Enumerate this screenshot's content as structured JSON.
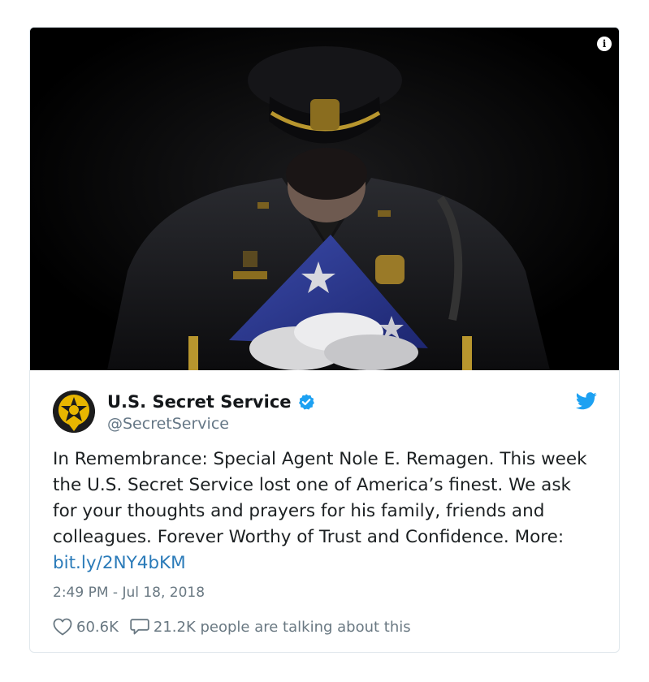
{
  "media": {
    "info_icon": "info-icon",
    "info_glyph": "i"
  },
  "author": {
    "display_name": "U.S. Secret Service",
    "handle": "@SecretService",
    "verified_icon": "verified-badge-icon",
    "avatar_icon": "secret-service-star-badge-icon"
  },
  "platform_icon": "twitter-bird-icon",
  "tweet": {
    "text": "In Remembrance: Special Agent Nole E. Remagen. This week the U.S. Secret Service lost one of America’s finest. We ask for your thoughts and prayers for his family, friends and colleagues. Forever Worthy of Trust and Confidence. More: ",
    "link": "bit.ly/2NY4bKM",
    "timestamp": "2:49 PM - Jul 18, 2018"
  },
  "actions": {
    "like_icon": "heart-icon",
    "like_count": "60.6K",
    "reply_icon": "speech-bubble-icon",
    "talking_text": "21.2K people are talking about this"
  },
  "colors": {
    "link": "#2b7bb9",
    "verified": "#1da1f2",
    "twitter_blue": "#1da1f2",
    "secondary_text": "#697882",
    "badge_gold": "#e8b600"
  }
}
